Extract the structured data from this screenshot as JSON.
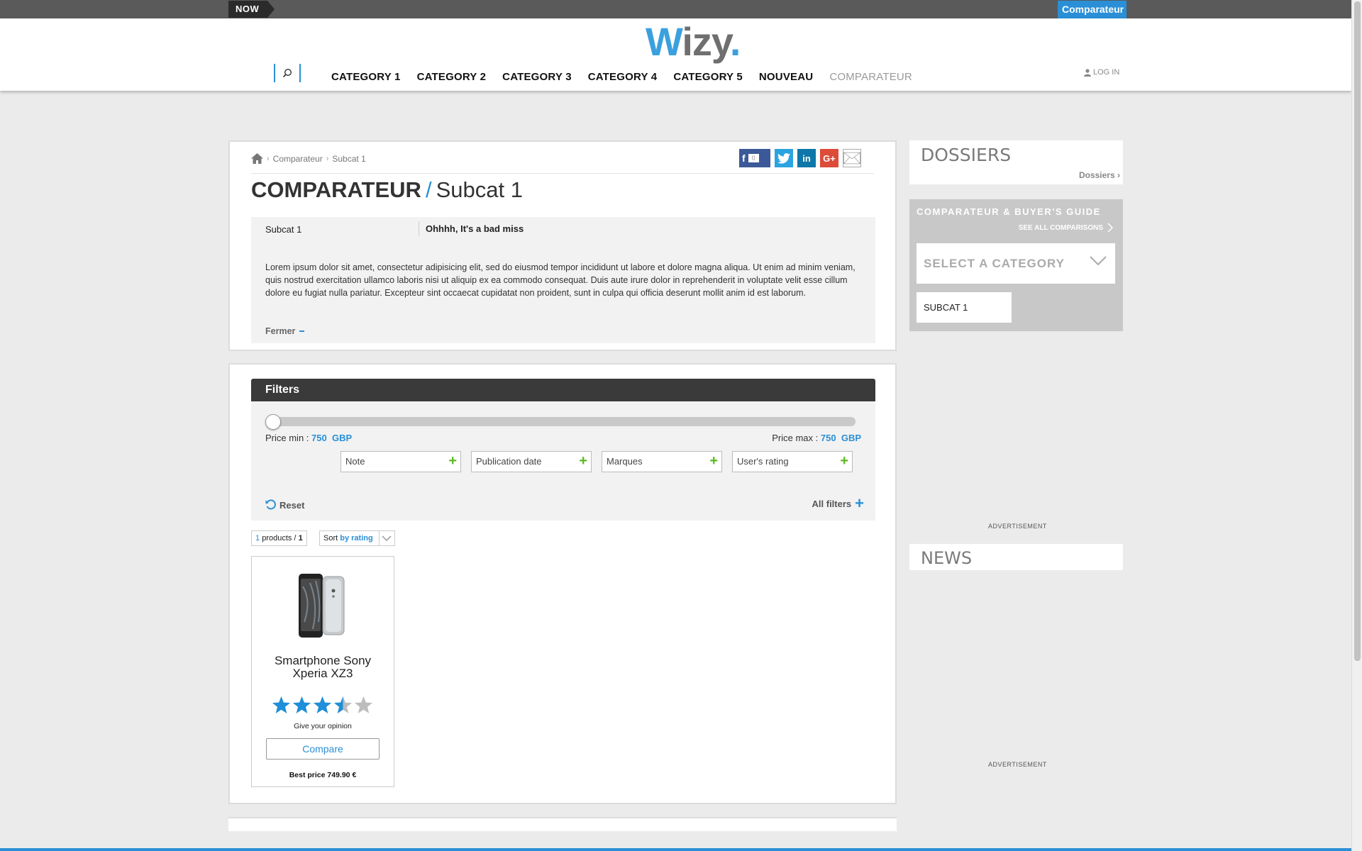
{
  "topbar": {
    "now_label": "NOW",
    "comparateur_label": "Comparateur"
  },
  "header": {
    "logo": {
      "first": "W",
      "rest": "izy",
      "dot": "."
    },
    "nav": [
      "CATEGORY 1",
      "CATEGORY 2",
      "CATEGORY 3",
      "CATEGORY 4",
      "CATEGORY 5",
      "NOUVEAU",
      "COMPARATEUR"
    ],
    "login_label": "LOG IN"
  },
  "breadcrumb": {
    "items": [
      "Comparateur",
      "Subcat 1"
    ]
  },
  "social": {
    "fb_count": "0"
  },
  "page_title": {
    "main": "COMPARATEUR",
    "separator": "/",
    "sub": "Subcat 1"
  },
  "info": {
    "left": "Subcat 1",
    "right": "Ohhhh, It's a bad miss",
    "text": "Lorem ipsum dolor sit amet, consectetur adipisicing elit, sed do eiusmod tempor incididunt ut labore et dolore magna aliqua. Ut enim ad minim veniam, quis nostrud exercitation ullamco laboris nisi ut aliquip ex ea commodo consequat. Duis aute irure dolor in reprehenderit in voluptate velit esse cillum dolore eu fugiat nulla pariatur. Excepteur sint occaecat cupidatat non proident, sunt in culpa qui officia deserunt mollit anim id est laborum.",
    "close_label": "Fermer"
  },
  "filters": {
    "title": "Filters",
    "price_min_label": "Price min :",
    "price_min_value": "750",
    "price_max_label": "Price max :",
    "price_max_value": "750",
    "currency": "GBP",
    "slider_position": 0,
    "dropdowns": [
      "Note",
      "Publication date",
      "Marques",
      "User's rating"
    ],
    "reset_label": "Reset",
    "all_filters_label": "All filters"
  },
  "results": {
    "count": "1",
    "count_label": "products /",
    "total": "1",
    "sort_label": "Sort",
    "sort_value": "by rating"
  },
  "products": [
    {
      "name": "Smartphone Sony Xperia XZ3",
      "rating": 3.5,
      "rating_max": 5,
      "opinion_label": "Give your opinion",
      "compare_label": "Compare",
      "best_price": "Best price 749.90 €"
    }
  ],
  "sidebar": {
    "dossiers_title": "DOSSIERS",
    "dossiers_link": "Dossiers",
    "guide_title": "COMPARATEUR & BUYER'S GUIDE",
    "see_all": "SEE ALL COMPARISONS",
    "select_placeholder": "SELECT A CATEGORY",
    "subcat_label": "SUBCAT 1",
    "ad_label": "ADVERTISEMENT",
    "news_title": "NEWS"
  },
  "colors": {
    "accent": "#2a8fd6",
    "dark": "#3a3a3a",
    "plus_green": "#5cb820",
    "star": "#1e8fd8"
  }
}
